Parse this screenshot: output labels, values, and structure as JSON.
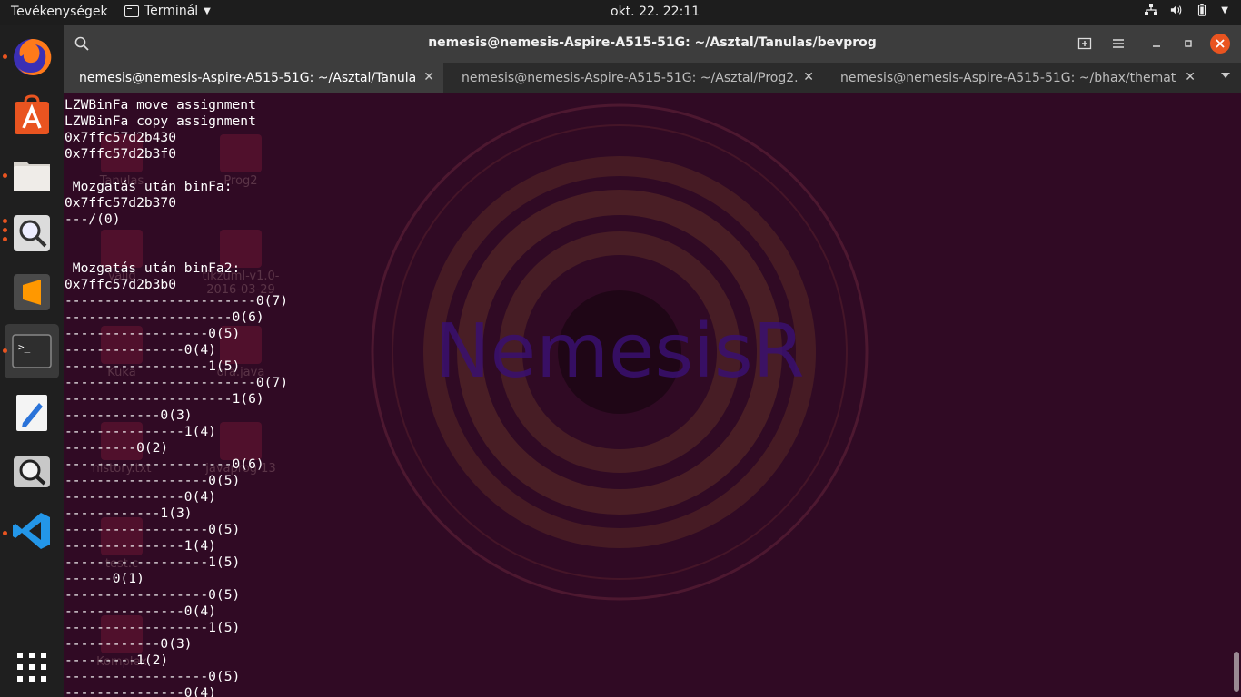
{
  "topbar": {
    "activities": "Tevékenységek",
    "app_menu": "Terminál",
    "clock": "okt. 22.  22:11"
  },
  "dock": {
    "apps": [
      "firefox-icon",
      "ubuntu-software-icon",
      "files-icon",
      "image-viewer-icon",
      "sublime-text-icon",
      "terminal-icon",
      "text-editor-icon",
      "search-icon",
      "vscode-icon"
    ],
    "show_apps": "show-applications-icon"
  },
  "window": {
    "title": "nemesis@nemesis-Aspire-A515-51G: ~/Asztal/Tanulas/bevprog",
    "tabs": [
      {
        "label": "nemesis@nemesis-Aspire-A515-51G: ~/Asztal/Tanula..."
      },
      {
        "label": "nemesis@nemesis-Aspire-A515-51G: ~/Asztal/Prog2..."
      },
      {
        "label": "nemesis@nemesis-Aspire-A515-51G: ~/bhax/themati..."
      }
    ]
  },
  "desktop_icons": [
    {
      "label": "Tanulas"
    },
    {
      "label": "Prog2"
    },
    {
      "label": "Valid"
    },
    {
      "label": "tikzuml-v1.0-2016-03-29"
    },
    {
      "label": "Kuka"
    },
    {
      "label": "ora.java"
    },
    {
      "label": "history.txt"
    },
    {
      "label": "javaprog 13"
    },
    {
      "label": "test.c"
    },
    {
      "label": "Komplex"
    }
  ],
  "wallpaper": {
    "text": "NemesisR"
  },
  "terminal": {
    "lines": [
      "LZWBinFa move assignment",
      "LZWBinFa copy assignment",
      "0x7ffc57d2b430",
      "0x7ffc57d2b3f0",
      "",
      " Mozgatás után binFa:",
      "0x7ffc57d2b370",
      "---/(0)",
      "",
      "",
      " Mozgatás után binFa2:",
      "0x7ffc57d2b3b0",
      "------------------------0(7)",
      "---------------------0(6)",
      "------------------0(5)",
      "---------------0(4)",
      "------------------1(5)",
      "------------------------0(7)",
      "---------------------1(6)",
      "------------0(3)",
      "---------------1(4)",
      "---------0(2)",
      "---------------------0(6)",
      "------------------0(5)",
      "---------------0(4)",
      "------------1(3)",
      "------------------0(5)",
      "---------------1(4)",
      "------------------1(5)",
      "------0(1)",
      "------------------0(5)",
      "---------------0(4)",
      "------------------1(5)",
      "------------0(3)",
      "---------1(2)",
      "------------------0(5)",
      "---------------0(4)"
    ]
  }
}
